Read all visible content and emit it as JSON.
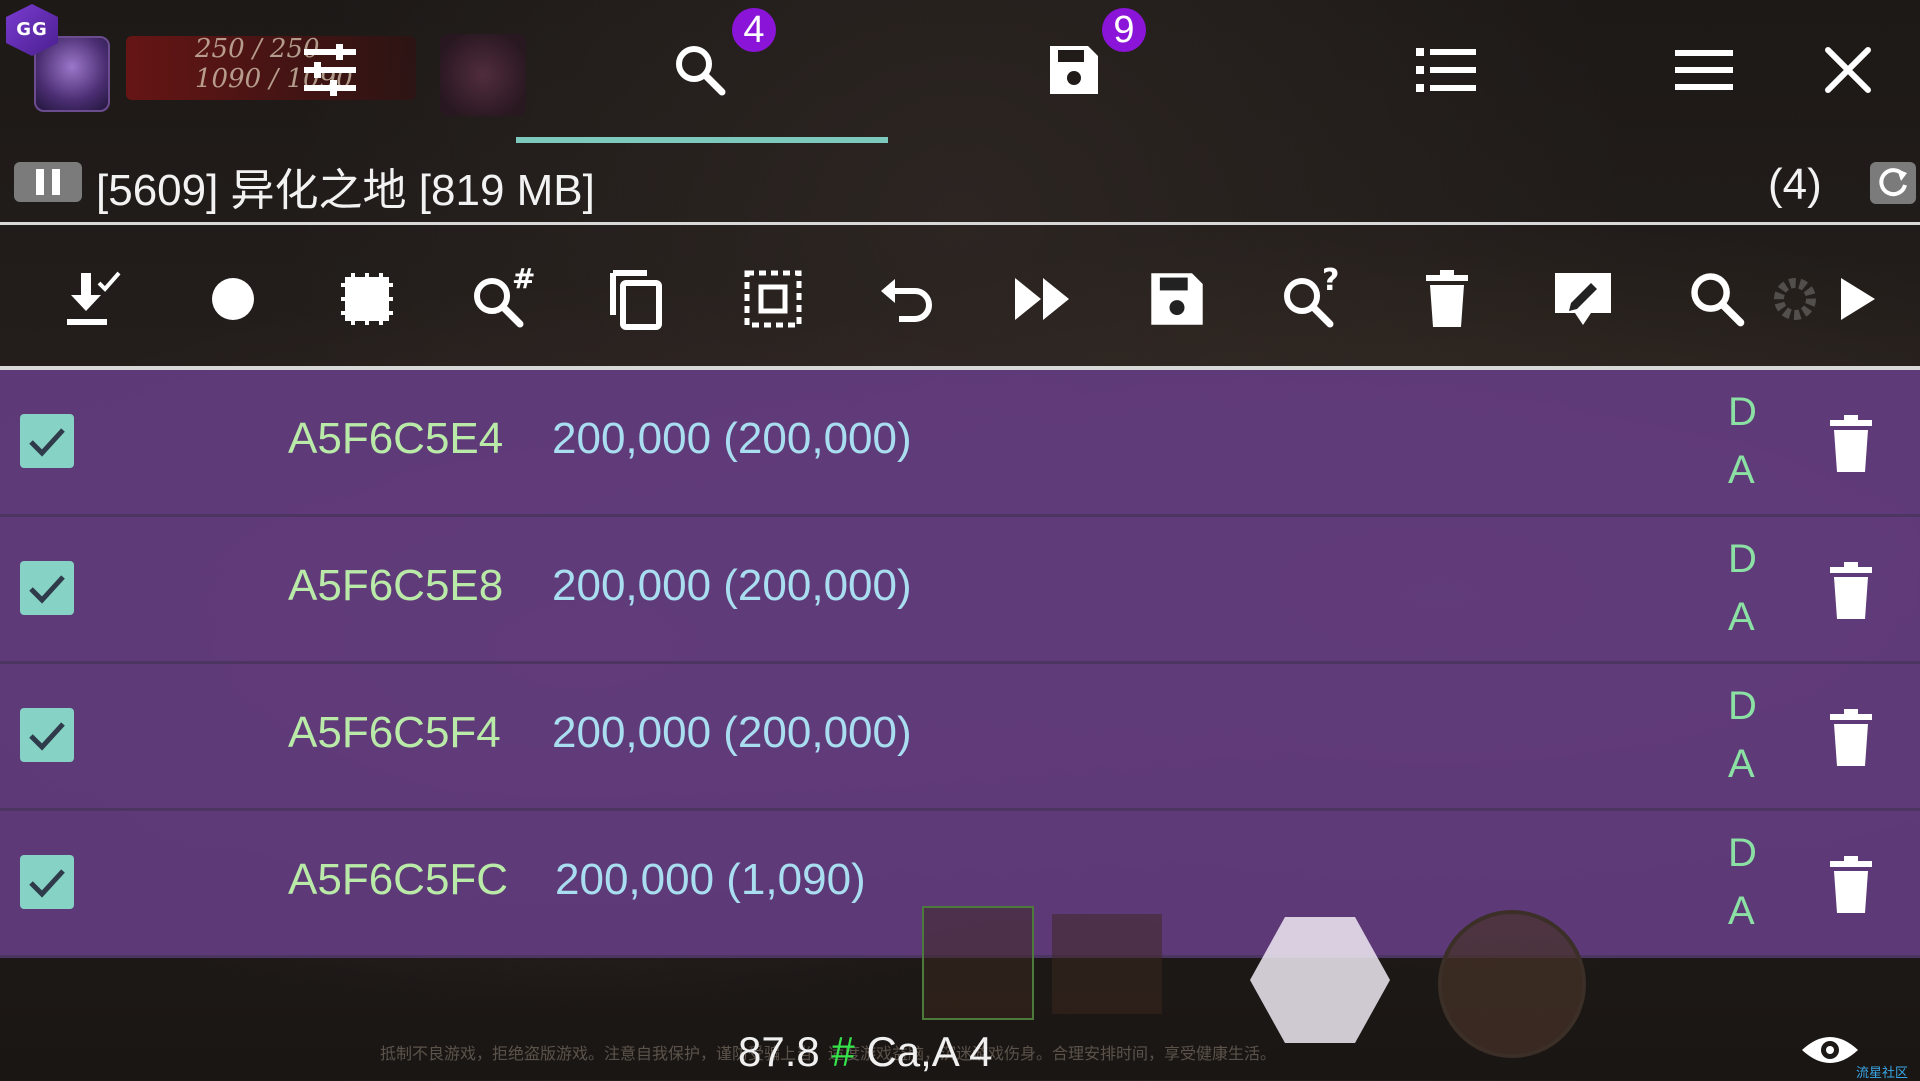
{
  "top_tabs": {
    "search_badge": "4",
    "saved_badge": "9"
  },
  "game_hud": {
    "line1": "250 / 250",
    "line2": "1090 / 1090"
  },
  "process": {
    "label": "[5609] 异化之地 [819 MB]",
    "count": "(4)"
  },
  "toolbar": {
    "icons": [
      "import-check-icon",
      "record-icon",
      "memory-range-icon",
      "search-number-icon",
      "copy-icon",
      "select-all-icon",
      "undo-icon",
      "fast-forward-icon",
      "save-icon",
      "search-unknown-icon",
      "delete-icon",
      "edit-icon",
      "search-icon",
      "settings-icon",
      "play-icon"
    ]
  },
  "results": [
    {
      "address": "A5F6C5E4",
      "value": "200,000 (200,000)",
      "type_line1": "D",
      "type_line2": "A"
    },
    {
      "address": "A5F6C5E8",
      "value": "200,000 (200,000)",
      "type_line1": "D",
      "type_line2": "A"
    },
    {
      "address": "A5F6C5F4",
      "value": "200,000 (200,000)",
      "type_line1": "D",
      "type_line2": "A"
    },
    {
      "address": "A5F6C5FC",
      "value": "200,000 (1,090)",
      "type_line1": "D",
      "type_line2": "A"
    }
  ],
  "status": {
    "speed": "87.8",
    "hash": "#",
    "regions": "Ca,A 4"
  },
  "background_text": {
    "warning": "抵制不良游戏，拒绝盗版游戏。注意自我保护，谨防受骗上当。适度游戏益脑，沉迷游戏伤身。合理安排时间，享受健康生活。",
    "corner": "流星社区"
  },
  "colors": {
    "tab_underline": "#7ec9bd",
    "badge": "#8a14d8",
    "row_bg": "#673e85",
    "checkbox": "#86d2c5",
    "address": "#b9eaa8",
    "value": "#a9ddf0",
    "type": "#8be0a3",
    "hash": "#34e34a"
  }
}
